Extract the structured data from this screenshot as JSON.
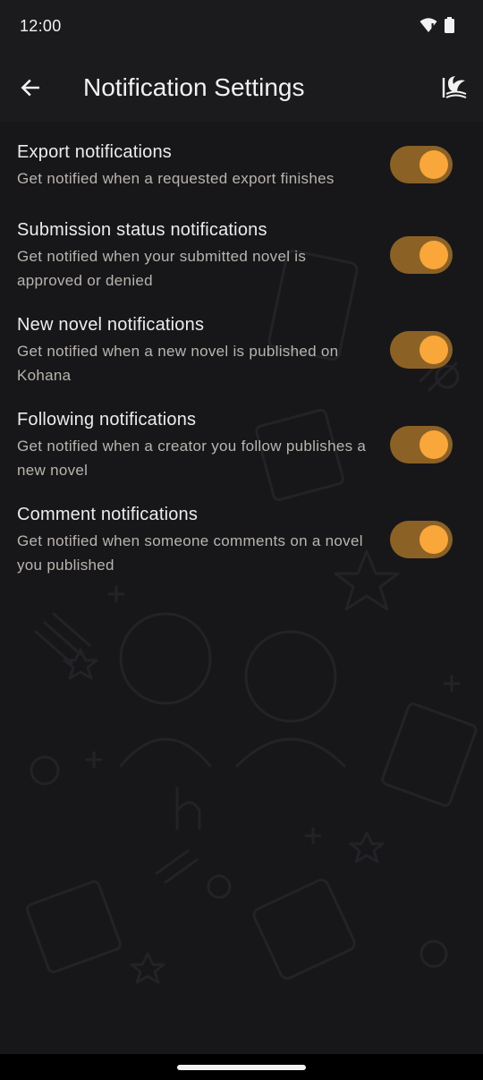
{
  "status_bar": {
    "time": "12:00",
    "icons": [
      "wifi-icon",
      "battery-icon"
    ]
  },
  "app_bar": {
    "back_icon": "arrow-left-icon",
    "title": "Notification Settings",
    "logo_icon": "kohana-logo-icon"
  },
  "settings": [
    {
      "title": "Export notifications",
      "description": "Get notified when a requested export finishes",
      "enabled": true
    },
    {
      "title": "Submission status notifications",
      "description": "Get notified when your submitted novel is approved or denied",
      "enabled": true
    },
    {
      "title": "New novel notifications",
      "description": "Get notified when a new novel is published on Kohana",
      "enabled": true
    },
    {
      "title": "Following notifications",
      "description": "Get notified when a creator you follow publishes a new novel",
      "enabled": true
    },
    {
      "title": "Comment notifications",
      "description": "Get notified when someone comments on a novel you published",
      "enabled": true
    }
  ],
  "colors": {
    "background": "#17171a",
    "toggle_track": "#8c6126",
    "toggle_knob": "#f9a73a",
    "title_text": "#ececec",
    "description_text": "#b9b4ad"
  }
}
